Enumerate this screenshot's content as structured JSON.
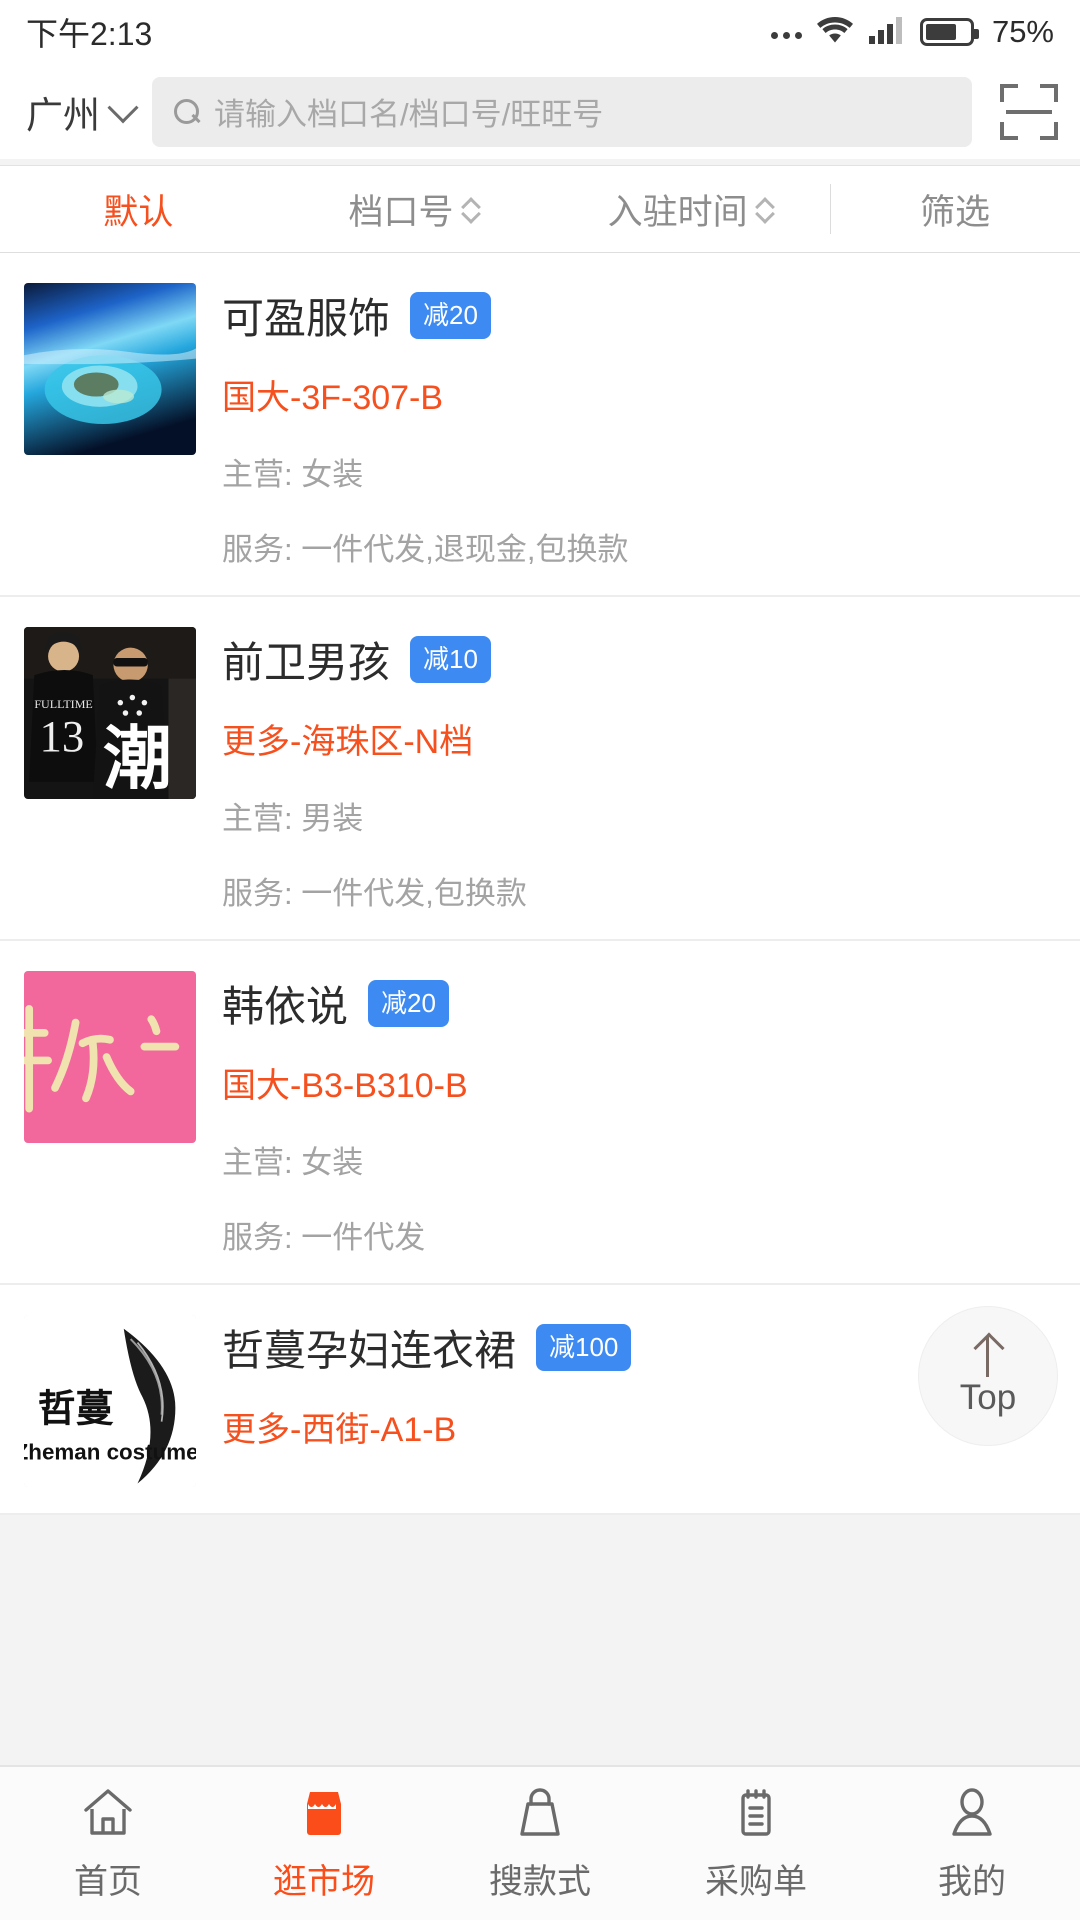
{
  "statusbar": {
    "time": "下午2:13",
    "battery_percent": "75%",
    "icons": [
      "more-dots-icon",
      "wifi-icon",
      "cellular-signal-icon",
      "battery-icon"
    ]
  },
  "header": {
    "city": "广州",
    "city_chevron_icon": "chevron-down-icon",
    "search_icon": "search-icon",
    "search_placeholder": "请输入档口名/档口号/旺旺号",
    "search_value": "",
    "scan_icon": "scan-code-icon"
  },
  "sort_tabs": {
    "active": "默认",
    "items": [
      {
        "label": "默认",
        "sortable": false,
        "active": true
      },
      {
        "label": "档口号",
        "sortable": true,
        "active": false
      },
      {
        "label": "入驻时间",
        "sortable": true,
        "active": false
      }
    ],
    "filter_label": "筛选",
    "accent_color": "#f5501e",
    "inactive_color": "#8d8d8d"
  },
  "stores": [
    {
      "name": "可盈服饰",
      "badge": "减20",
      "badge_color": "#3d8bf2",
      "location": "国大-3F-307-B",
      "location_color": "#f5501e",
      "category": "主营: 女装",
      "service": "服务: 一件代发,退现金,包换款",
      "thumb_name": "island-aerial-photo"
    },
    {
      "name": "前卫男孩",
      "badge": "减10",
      "badge_color": "#3d8bf2",
      "location": "更多-海珠区-N档",
      "location_color": "#f5501e",
      "category": "主营: 男装",
      "service": "服务: 一件代发,包换款",
      "thumb_name": "streetwear-models-photo"
    },
    {
      "name": "韩依说",
      "badge": "减20",
      "badge_color": "#3d8bf2",
      "location": "国大-B3-B310-B",
      "location_color": "#f5501e",
      "category": "主营: 女装",
      "service": "服务: 一件代发",
      "thumb_name": "pink-brand-logo"
    },
    {
      "name": "哲蔓孕妇连衣裙",
      "badge": "减100",
      "badge_color": "#3d8bf2",
      "location": "更多-西街-A1-B",
      "location_color": "#f5501e",
      "category": "",
      "service": "",
      "thumb_name": "zheman-costume-logo"
    }
  ],
  "top_button": {
    "label": "Top",
    "icon": "arrow-up-icon"
  },
  "bottom_nav": {
    "active": "逛市场",
    "items": [
      {
        "label": "首页",
        "icon": "home-icon",
        "active": false
      },
      {
        "label": "逛市场",
        "icon": "shop-icon",
        "active": true
      },
      {
        "label": "搜款式",
        "icon": "bag-icon",
        "active": false
      },
      {
        "label": "采购单",
        "icon": "clipboard-icon",
        "active": false
      },
      {
        "label": "我的",
        "icon": "user-icon",
        "active": false
      }
    ],
    "active_color": "#fa4d1a"
  }
}
